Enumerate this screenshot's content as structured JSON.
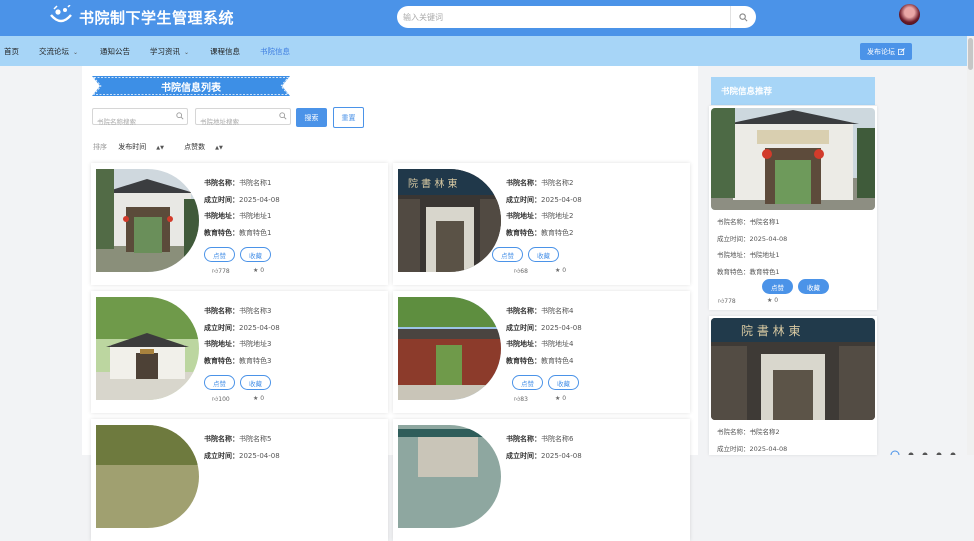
{
  "header": {
    "site_title": "书院制下学生管理系统",
    "search_placeholder": "输入关键词",
    "icons": {
      "logo": "logo-icon",
      "search": "search-icon",
      "avatar": "avatar"
    }
  },
  "nav": {
    "items": [
      {
        "label": "首页",
        "active": false,
        "dropdown": false
      },
      {
        "label": "交流论坛",
        "active": false,
        "dropdown": true
      },
      {
        "label": "通知公告",
        "active": false,
        "dropdown": false
      },
      {
        "label": "学习资讯",
        "active": false,
        "dropdown": true
      },
      {
        "label": "课程信息",
        "active": false,
        "dropdown": false
      },
      {
        "label": "书院信息",
        "active": true,
        "dropdown": false
      }
    ],
    "publish_label": "发布论坛"
  },
  "main": {
    "section_title": "书院信息列表",
    "filters": {
      "name_placeholder": "书院名称搜索",
      "address_placeholder": "书院地址搜索",
      "search_label": "搜索",
      "reset_label": "重置"
    },
    "sort": {
      "label": "排序",
      "options": [
        "发布时间",
        "点赞数"
      ]
    },
    "field_labels": {
      "name": "书院名称：",
      "date": "成立时间：",
      "address": "书院地址：",
      "feature": "教育特色："
    },
    "like_label": "点赞",
    "fav_label": "收藏",
    "cards": [
      {
        "name": "书院名称1",
        "date": "2025-04-08",
        "address": "书院地址1",
        "feature": "教育特色1",
        "likes": "778",
        "favs": "0"
      },
      {
        "name": "书院名称2",
        "date": "2025-04-08",
        "address": "书院地址2",
        "feature": "教育特色2",
        "likes": "68",
        "favs": "0"
      },
      {
        "name": "书院名称3",
        "date": "2025-04-08",
        "address": "书院地址3",
        "feature": "教育特色3",
        "likes": "100",
        "favs": "0"
      },
      {
        "name": "书院名称4",
        "date": "2025-04-08",
        "address": "书院地址4",
        "feature": "教育特色4",
        "likes": "83",
        "favs": "0"
      },
      {
        "name": "书院名称5",
        "date": "2025-04-08",
        "address": "",
        "feature": "",
        "likes": "",
        "favs": ""
      },
      {
        "name": "书院名称6",
        "date": "2025-04-08",
        "address": "",
        "feature": "",
        "likes": "",
        "favs": ""
      }
    ]
  },
  "sidebar": {
    "title": "书院信息推荐",
    "field_labels": {
      "name": "书院名称：",
      "date": "成立时间：",
      "address": "书院地址：",
      "feature": "教育特色："
    },
    "like_label": "点赞",
    "fav_label": "收藏",
    "items": [
      {
        "name": "书院名称1",
        "date": "2025-04-08",
        "address": "书院地址1",
        "feature": "教育特色1",
        "likes": "778",
        "favs": "0"
      },
      {
        "name": "书院名称2",
        "date": "2025-04-08",
        "address": "",
        "feature": "",
        "likes": "",
        "favs": ""
      }
    ]
  },
  "colors": {
    "brand": "#4b93e8",
    "nav_bg": "#a7d5f7",
    "active_nav": "#3d7de0"
  }
}
